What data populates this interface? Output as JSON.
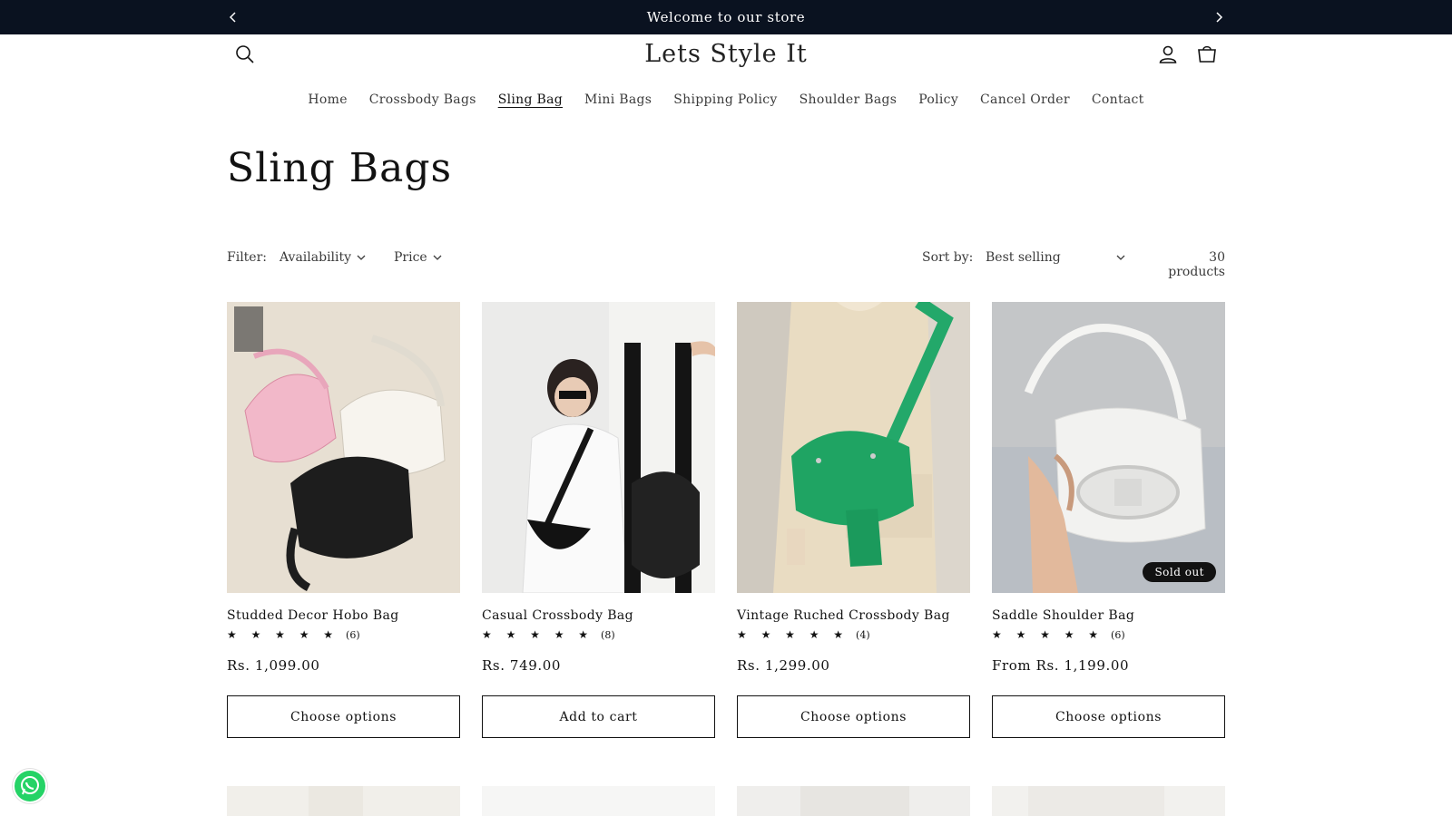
{
  "announcement": {
    "message": "Welcome to our store",
    "prev_icon": "chevron-left-icon",
    "next_icon": "chevron-right-icon"
  },
  "header": {
    "logo": "Lets Style It",
    "icons": [
      "search-icon",
      "account-icon",
      "cart-icon"
    ]
  },
  "nav": [
    {
      "label": "Home",
      "active": false
    },
    {
      "label": "Crossbody Bags",
      "active": false
    },
    {
      "label": "Sling Bag",
      "active": true
    },
    {
      "label": "Mini Bags",
      "active": false
    },
    {
      "label": "Shipping Policy",
      "active": false
    },
    {
      "label": "Shoulder Bags",
      "active": false
    },
    {
      "label": "Policy",
      "active": false
    },
    {
      "label": "Cancel Order",
      "active": false
    },
    {
      "label": "Contact",
      "active": false
    }
  ],
  "collection": {
    "title": "Sling Bags"
  },
  "filters": {
    "label": "Filter:",
    "availability": "Availability",
    "price": "Price",
    "sort_label": "Sort by:",
    "sort_value": "Best selling",
    "product_count": "30 products"
  },
  "products": [
    {
      "title": "Studded Decor Hobo Bag",
      "stars": "★ ★ ★ ★ ★",
      "review_count": "(6)",
      "price": "Rs. 1,099.00",
      "button": "Choose options",
      "sold_out": false
    },
    {
      "title": "Casual Crossbody Bag",
      "stars": "★ ★ ★ ★ ★",
      "review_count": "(8)",
      "price": "Rs. 749.00",
      "button": "Add to cart",
      "sold_out": false
    },
    {
      "title": "Vintage Ruched Crossbody Bag",
      "stars": "★ ★ ★ ★ ★",
      "review_count": "(4)",
      "price": "Rs. 1,299.00",
      "button": "Choose options",
      "sold_out": false
    },
    {
      "title": "Saddle Shoulder Bag",
      "stars": "★ ★ ★ ★ ★",
      "review_count": "(6)",
      "price": "From Rs. 1,199.00",
      "button": "Choose options",
      "sold_out": true,
      "badge": "Sold out"
    }
  ],
  "colors": {
    "announcement_bg": "#0a1220",
    "text": "#121212",
    "whatsapp": "#25d366"
  }
}
